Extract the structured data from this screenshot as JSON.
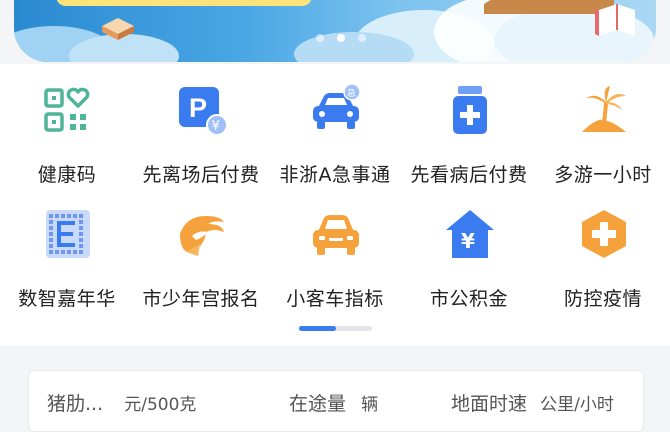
{
  "banner": {
    "page_count": 3,
    "active_page": 2
  },
  "services": {
    "row1": [
      {
        "label": "健康码",
        "icon": "health-code-icon"
      },
      {
        "label": "先离场后付费",
        "icon": "parking-pay-icon"
      },
      {
        "label": "非浙A急事通",
        "icon": "car-urgent-icon"
      },
      {
        "label": "先看病后付费",
        "icon": "medical-bottle-icon"
      },
      {
        "label": "多游一小时",
        "icon": "beach-palm-icon"
      }
    ],
    "row2": [
      {
        "label": "数智嘉年华",
        "icon": "digital-grid-icon"
      },
      {
        "label": "市少年宫报名",
        "icon": "youth-palace-icon"
      },
      {
        "label": "小客车指标",
        "icon": "passenger-car-icon"
      },
      {
        "label": "市公积金",
        "icon": "housing-fund-icon"
      },
      {
        "label": "防控疫情",
        "icon": "epidemic-plus-icon"
      }
    ],
    "pager_progress": 0.5
  },
  "stats": {
    "pork": {
      "label": "猪肋...",
      "unit": "元/500克"
    },
    "transit": {
      "label": "在途量",
      "unit": "辆"
    },
    "speed": {
      "label": "地面时速",
      "unit": "公里/小时"
    }
  },
  "colors": {
    "accent_blue": "#3a7bf0",
    "teal": "#4fb49a",
    "orange": "#f6a23c",
    "text": "#222222"
  }
}
